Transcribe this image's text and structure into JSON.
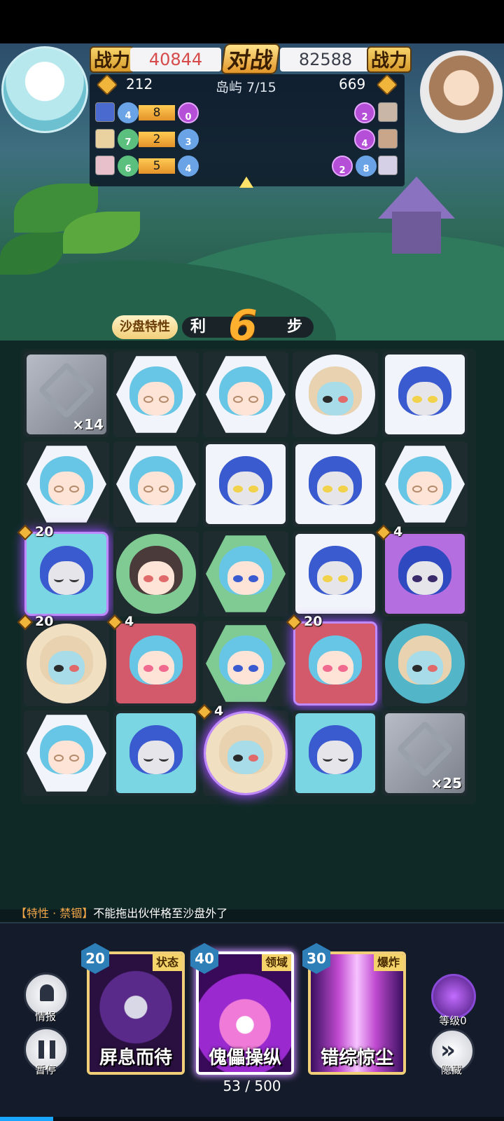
{
  "header": {
    "power_label_left": "战力",
    "power_left": "40844",
    "vs_label": "对战",
    "power_right": "82588",
    "power_label_right": "战力",
    "gold_left": "212",
    "island": "岛屿 7/15",
    "gold_right": "669"
  },
  "left_units": [
    {
      "a": "4",
      "bar": "8",
      "b": "0"
    },
    {
      "a": "7",
      "bar": "2",
      "b": "3"
    },
    {
      "a": "6",
      "bar": "5",
      "b": "4"
    }
  ],
  "right_units": [
    {
      "v1": "2"
    },
    {
      "v1": "4"
    },
    {
      "v1": "2",
      "v2": "8"
    }
  ],
  "steps": {
    "tag": "沙盘特性",
    "remain": "利",
    "count": "6",
    "unit": "步"
  },
  "board": {
    "badges": {
      "r2c0": "20",
      "r2c4": "4",
      "r3c0": "20",
      "r3c1": "4",
      "r3c3": "20",
      "r4c2": "4"
    },
    "stone_counts": {
      "r0c0": "×14",
      "r4c4": "×25"
    }
  },
  "hint": {
    "tag": "【特性 · 禁锢】",
    "text": "不能拖出伙伴格至沙盘外了"
  },
  "bottom": {
    "info_label": "情报",
    "pause_label": "暂停",
    "level_label": "等级0",
    "hide_label": "隐藏",
    "energy": "53 / 500",
    "energy_fraction": 0.106,
    "cards": [
      {
        "cost": "20",
        "type": "状态",
        "name": "屏息而待"
      },
      {
        "cost": "40",
        "type": "领域",
        "name": "傀儡操纵"
      },
      {
        "cost": "30",
        "type": "爆炸",
        "name": "错综惊尘"
      }
    ]
  },
  "colors": {
    "accent": "#f1cf78",
    "glow": "#a14cff",
    "power_left": "#d64a4a"
  }
}
